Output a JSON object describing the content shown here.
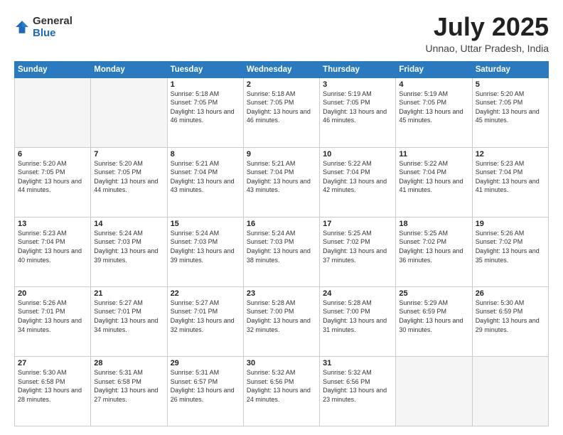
{
  "header": {
    "logo_general": "General",
    "logo_blue": "Blue",
    "month_year": "July 2025",
    "location": "Unnao, Uttar Pradesh, India"
  },
  "days_of_week": [
    "Sunday",
    "Monday",
    "Tuesday",
    "Wednesday",
    "Thursday",
    "Friday",
    "Saturday"
  ],
  "weeks": [
    [
      {
        "day": "",
        "info": ""
      },
      {
        "day": "",
        "info": ""
      },
      {
        "day": "1",
        "info": "Sunrise: 5:18 AM\nSunset: 7:05 PM\nDaylight: 13 hours and 46 minutes."
      },
      {
        "day": "2",
        "info": "Sunrise: 5:18 AM\nSunset: 7:05 PM\nDaylight: 13 hours and 46 minutes."
      },
      {
        "day": "3",
        "info": "Sunrise: 5:19 AM\nSunset: 7:05 PM\nDaylight: 13 hours and 46 minutes."
      },
      {
        "day": "4",
        "info": "Sunrise: 5:19 AM\nSunset: 7:05 PM\nDaylight: 13 hours and 45 minutes."
      },
      {
        "day": "5",
        "info": "Sunrise: 5:20 AM\nSunset: 7:05 PM\nDaylight: 13 hours and 45 minutes."
      }
    ],
    [
      {
        "day": "6",
        "info": "Sunrise: 5:20 AM\nSunset: 7:05 PM\nDaylight: 13 hours and 44 minutes."
      },
      {
        "day": "7",
        "info": "Sunrise: 5:20 AM\nSunset: 7:05 PM\nDaylight: 13 hours and 44 minutes."
      },
      {
        "day": "8",
        "info": "Sunrise: 5:21 AM\nSunset: 7:04 PM\nDaylight: 13 hours and 43 minutes."
      },
      {
        "day": "9",
        "info": "Sunrise: 5:21 AM\nSunset: 7:04 PM\nDaylight: 13 hours and 43 minutes."
      },
      {
        "day": "10",
        "info": "Sunrise: 5:22 AM\nSunset: 7:04 PM\nDaylight: 13 hours and 42 minutes."
      },
      {
        "day": "11",
        "info": "Sunrise: 5:22 AM\nSunset: 7:04 PM\nDaylight: 13 hours and 41 minutes."
      },
      {
        "day": "12",
        "info": "Sunrise: 5:23 AM\nSunset: 7:04 PM\nDaylight: 13 hours and 41 minutes."
      }
    ],
    [
      {
        "day": "13",
        "info": "Sunrise: 5:23 AM\nSunset: 7:04 PM\nDaylight: 13 hours and 40 minutes."
      },
      {
        "day": "14",
        "info": "Sunrise: 5:24 AM\nSunset: 7:03 PM\nDaylight: 13 hours and 39 minutes."
      },
      {
        "day": "15",
        "info": "Sunrise: 5:24 AM\nSunset: 7:03 PM\nDaylight: 13 hours and 39 minutes."
      },
      {
        "day": "16",
        "info": "Sunrise: 5:24 AM\nSunset: 7:03 PM\nDaylight: 13 hours and 38 minutes."
      },
      {
        "day": "17",
        "info": "Sunrise: 5:25 AM\nSunset: 7:02 PM\nDaylight: 13 hours and 37 minutes."
      },
      {
        "day": "18",
        "info": "Sunrise: 5:25 AM\nSunset: 7:02 PM\nDaylight: 13 hours and 36 minutes."
      },
      {
        "day": "19",
        "info": "Sunrise: 5:26 AM\nSunset: 7:02 PM\nDaylight: 13 hours and 35 minutes."
      }
    ],
    [
      {
        "day": "20",
        "info": "Sunrise: 5:26 AM\nSunset: 7:01 PM\nDaylight: 13 hours and 34 minutes."
      },
      {
        "day": "21",
        "info": "Sunrise: 5:27 AM\nSunset: 7:01 PM\nDaylight: 13 hours and 34 minutes."
      },
      {
        "day": "22",
        "info": "Sunrise: 5:27 AM\nSunset: 7:01 PM\nDaylight: 13 hours and 32 minutes."
      },
      {
        "day": "23",
        "info": "Sunrise: 5:28 AM\nSunset: 7:00 PM\nDaylight: 13 hours and 32 minutes."
      },
      {
        "day": "24",
        "info": "Sunrise: 5:28 AM\nSunset: 7:00 PM\nDaylight: 13 hours and 31 minutes."
      },
      {
        "day": "25",
        "info": "Sunrise: 5:29 AM\nSunset: 6:59 PM\nDaylight: 13 hours and 30 minutes."
      },
      {
        "day": "26",
        "info": "Sunrise: 5:30 AM\nSunset: 6:59 PM\nDaylight: 13 hours and 29 minutes."
      }
    ],
    [
      {
        "day": "27",
        "info": "Sunrise: 5:30 AM\nSunset: 6:58 PM\nDaylight: 13 hours and 28 minutes."
      },
      {
        "day": "28",
        "info": "Sunrise: 5:31 AM\nSunset: 6:58 PM\nDaylight: 13 hours and 27 minutes."
      },
      {
        "day": "29",
        "info": "Sunrise: 5:31 AM\nSunset: 6:57 PM\nDaylight: 13 hours and 26 minutes."
      },
      {
        "day": "30",
        "info": "Sunrise: 5:32 AM\nSunset: 6:56 PM\nDaylight: 13 hours and 24 minutes."
      },
      {
        "day": "31",
        "info": "Sunrise: 5:32 AM\nSunset: 6:56 PM\nDaylight: 13 hours and 23 minutes."
      },
      {
        "day": "",
        "info": ""
      },
      {
        "day": "",
        "info": ""
      }
    ]
  ]
}
